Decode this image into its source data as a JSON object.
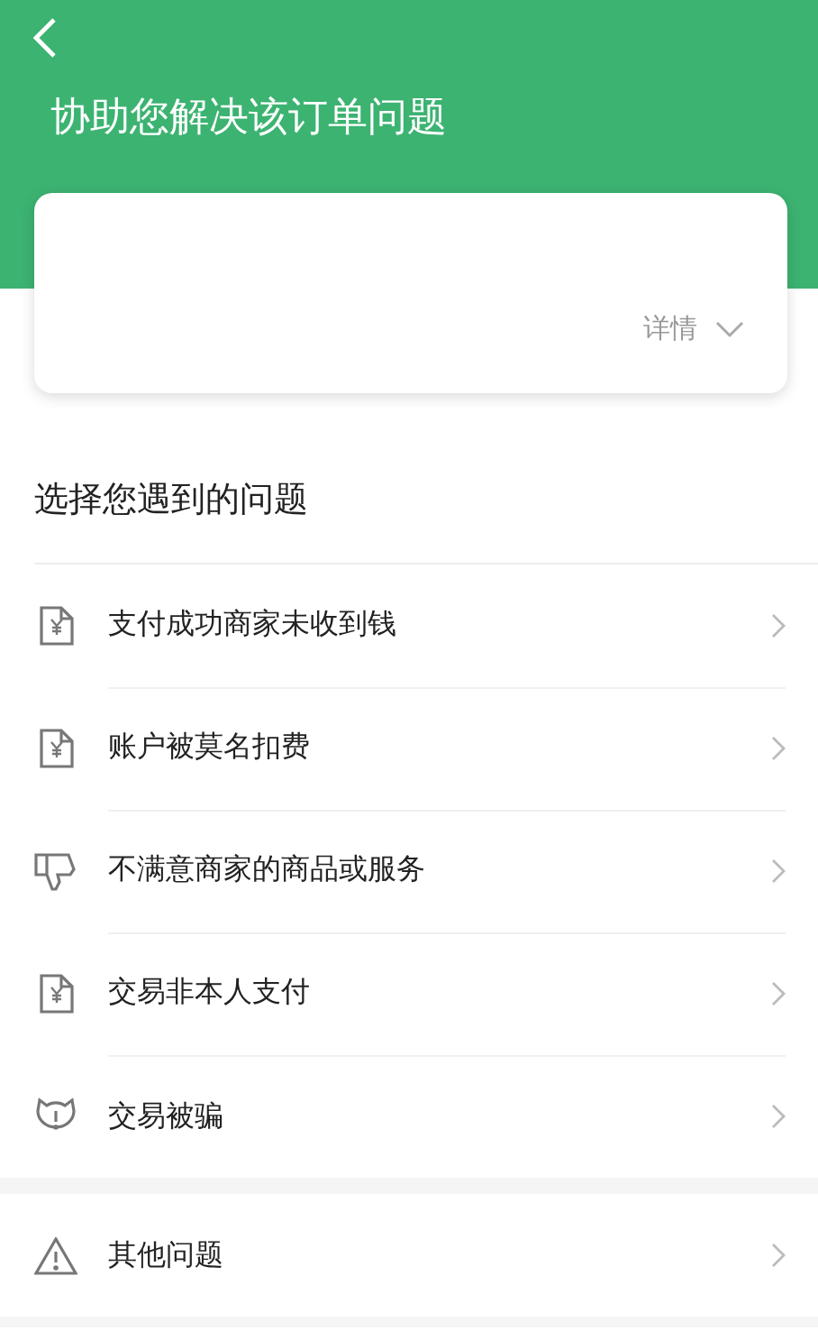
{
  "header": {
    "title": "协助您解决该订单问题"
  },
  "order_card": {
    "details_link": "详情",
    "expanded": false
  },
  "section_title": "选择您遇到的问题",
  "problems": [
    {
      "kind": "receipt",
      "label": "支付成功商家未收到钱"
    },
    {
      "kind": "receipt",
      "label": "账户被莫名扣费"
    },
    {
      "kind": "dislike",
      "label": "不满意商家的商品或服务"
    },
    {
      "kind": "receipt",
      "label": "交易非本人支付"
    },
    {
      "kind": "scam",
      "label": "交易被骗"
    }
  ],
  "other": [
    {
      "kind": "warning",
      "label": "其他问题"
    }
  ]
}
